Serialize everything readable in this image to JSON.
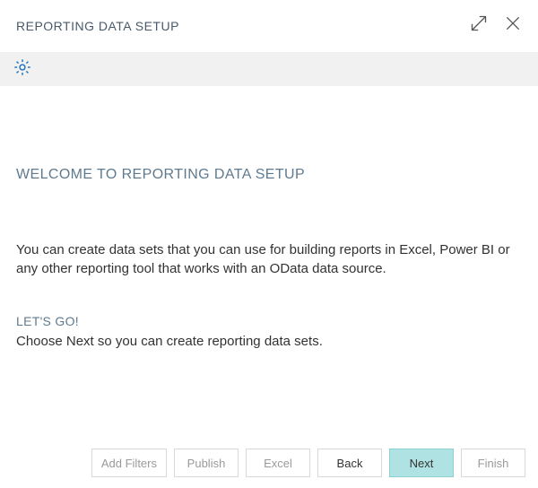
{
  "title": "REPORTING DATA SETUP",
  "content": {
    "welcome_heading": "WELCOME TO REPORTING DATA SETUP",
    "welcome_body": "You can create data sets that you can use for building reports in Excel, Power BI or any other reporting tool that works with an OData data source.",
    "lets_go_heading": "LET'S GO!",
    "lets_go_body": "Choose Next so you can create reporting data sets."
  },
  "footer": {
    "add_filters": "Add Filters",
    "publish": "Publish",
    "excel": "Excel",
    "back": "Back",
    "next": "Next",
    "finish": "Finish"
  }
}
